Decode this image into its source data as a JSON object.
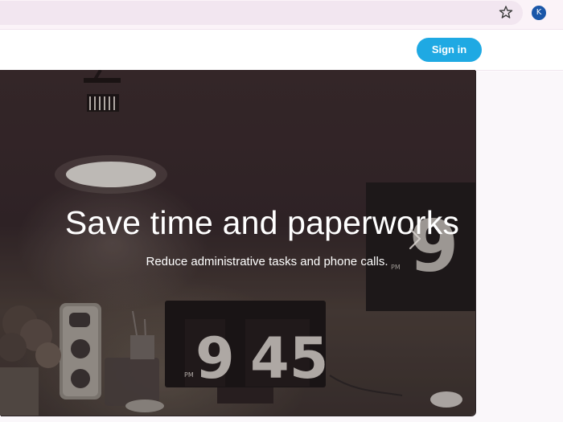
{
  "browser": {
    "bookmark_icon": "star-outline-icon",
    "profile_initial": "K",
    "profile_color": "#1a56a8"
  },
  "header": {
    "signin_label": "Sign in",
    "signin_color": "#1fa9e3"
  },
  "hero": {
    "title": "Save time and paperworks",
    "subtitle": "Reduce administrative tasks and phone calls.",
    "next_icon": "chevron-right-icon",
    "photo_clock_hour": "9",
    "photo_clock_minutes": "45",
    "photo_clock_pm": "PM"
  }
}
